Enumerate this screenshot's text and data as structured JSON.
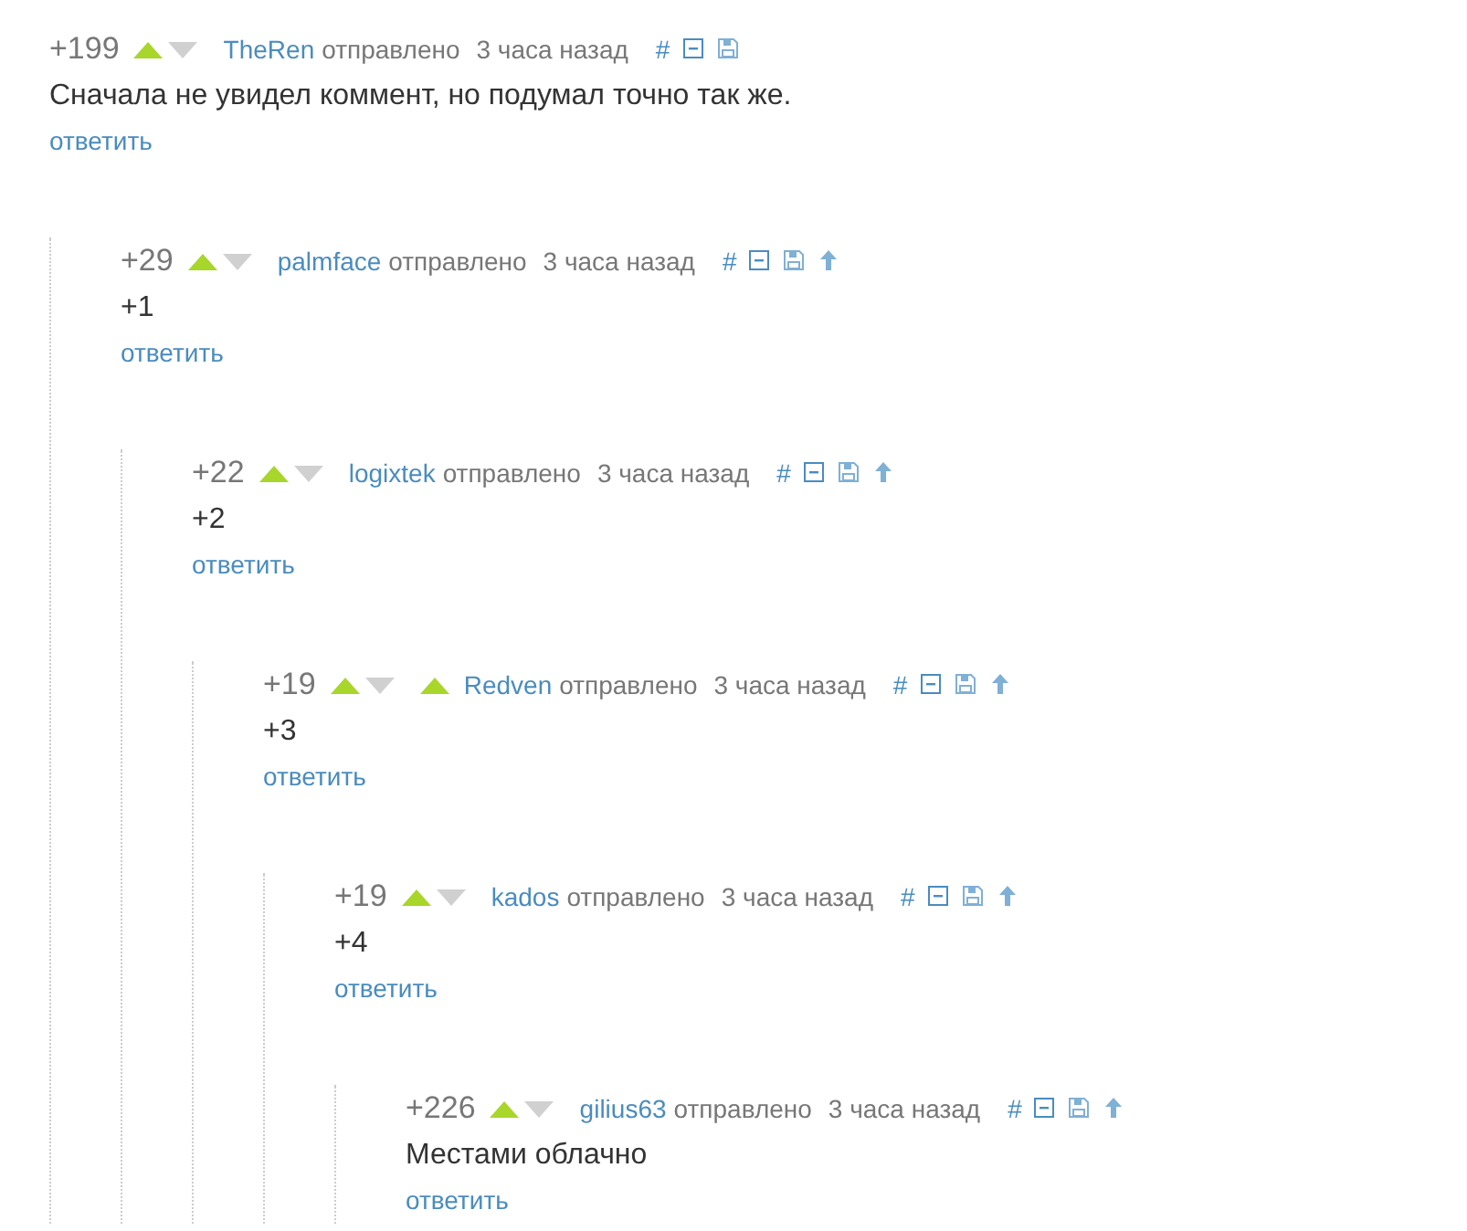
{
  "comments": [
    {
      "score": "+199",
      "upvoted": true,
      "downvoted": false,
      "parent_marker": false,
      "author": "TheRen",
      "sent": "отправлено",
      "time": "3 часа назад",
      "hash": "#",
      "up_link": false,
      "text": "Сначала не увидел коммент, но подумал точно так же.",
      "reply": "ответить",
      "children": [
        {
          "score": "+29",
          "upvoted": true,
          "downvoted": false,
          "parent_marker": false,
          "author": "palmface",
          "sent": "отправлено",
          "time": "3 часа назад",
          "hash": "#",
          "up_link": true,
          "text": "+1",
          "reply": "ответить",
          "children": [
            {
              "score": "+22",
              "upvoted": true,
              "downvoted": false,
              "parent_marker": false,
              "author": "logixtek",
              "sent": "отправлено",
              "time": "3 часа назад",
              "hash": "#",
              "up_link": true,
              "text": "+2",
              "reply": "ответить",
              "children": [
                {
                  "score": "+19",
                  "upvoted": true,
                  "downvoted": false,
                  "parent_marker": true,
                  "author": "Redven",
                  "sent": "отправлено",
                  "time": "3 часа назад",
                  "hash": "#",
                  "up_link": true,
                  "text": "+3",
                  "reply": "ответить",
                  "children": [
                    {
                      "score": "+19",
                      "upvoted": true,
                      "downvoted": false,
                      "parent_marker": false,
                      "author": "kados",
                      "sent": "отправлено",
                      "time": "3 часа назад",
                      "hash": "#",
                      "up_link": true,
                      "text": "+4",
                      "reply": "ответить",
                      "children": [
                        {
                          "score": "+226",
                          "upvoted": true,
                          "downvoted": false,
                          "parent_marker": false,
                          "author": "gilius63",
                          "sent": "отправлено",
                          "time": "3 часа назад",
                          "hash": "#",
                          "up_link": true,
                          "text": "Местами облачно",
                          "reply": "ответить"
                        }
                      ]
                    }
                  ]
                }
              ]
            }
          ]
        }
      ]
    }
  ]
}
